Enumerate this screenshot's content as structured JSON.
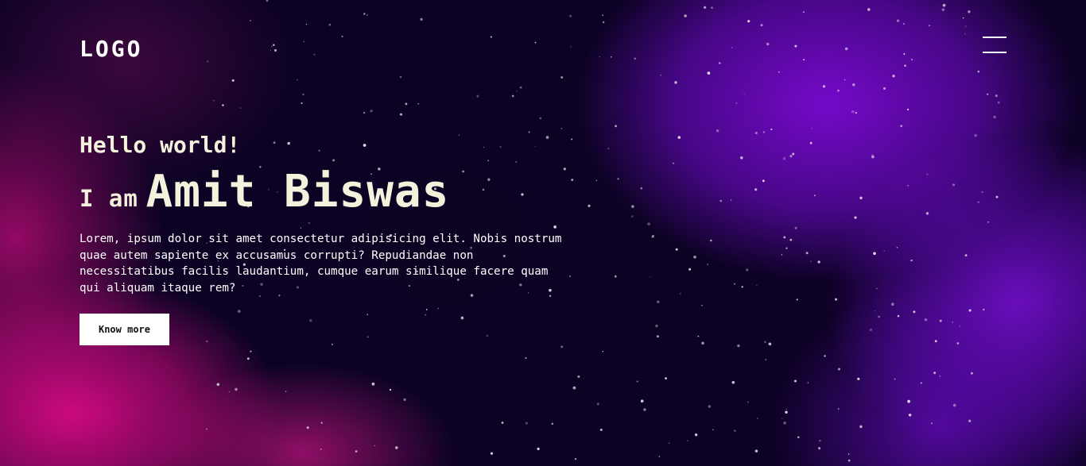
{
  "header": {
    "logo_text": "LOGO",
    "menu_icon": "hamburger-menu-icon"
  },
  "hero": {
    "greeting": "Hello world!",
    "intro_prefix": "I am",
    "name": "Amit Biswas",
    "description": "Lorem, ipsum dolor sit amet consectetur adipisicing elit. Nobis nostrum quae autem sapiente ex accusamus corrupti? Repudiandae non necessitatibus facilis laudantium, cumque earum similique facere quam qui aliquam itaque rem?",
    "cta_label": "Know more"
  },
  "colors": {
    "background_dark": "#0d0226",
    "nebula_purple": "#7a0ad2",
    "nebula_pink": "#d70a82",
    "heading_text": "#f4f1dc",
    "button_bg": "#ffffff",
    "button_text": "#111111"
  }
}
